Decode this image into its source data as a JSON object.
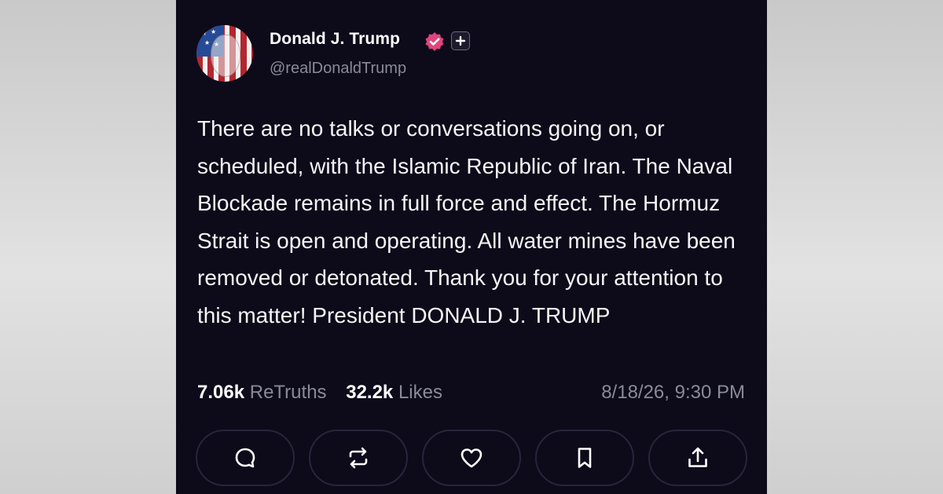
{
  "author": {
    "display_name": "Donald J. Trump",
    "handle": "@realDonaldTrump",
    "avatar": "flag-face-avatar",
    "verified_icon": "verified-badge-icon",
    "accent_color": "#e0457b"
  },
  "post": {
    "text": "There are no talks or conversations going on, or scheduled, with the Islamic Republic of Iran. The Naval Blockade remains in full force and effect. The Hormuz Strait is open and operating. All water mines have been removed or detonated. Thank you for your attention to this matter! President DONALD J. TRUMP"
  },
  "stats": {
    "retruths_count": "7.06k",
    "retruths_label": "ReTruths",
    "likes_count": "32.2k",
    "likes_label": "Likes",
    "timestamp": "8/18/26, 9:30 PM"
  },
  "actions": [
    {
      "icon": "reply-icon"
    },
    {
      "icon": "retruth-icon"
    },
    {
      "icon": "like-heart-icon"
    },
    {
      "icon": "bookmark-icon"
    },
    {
      "icon": "share-icon"
    }
  ],
  "colors": {
    "card_background": "#0d0b1a",
    "muted_text": "#8a8a99",
    "button_border": "#27253a"
  }
}
